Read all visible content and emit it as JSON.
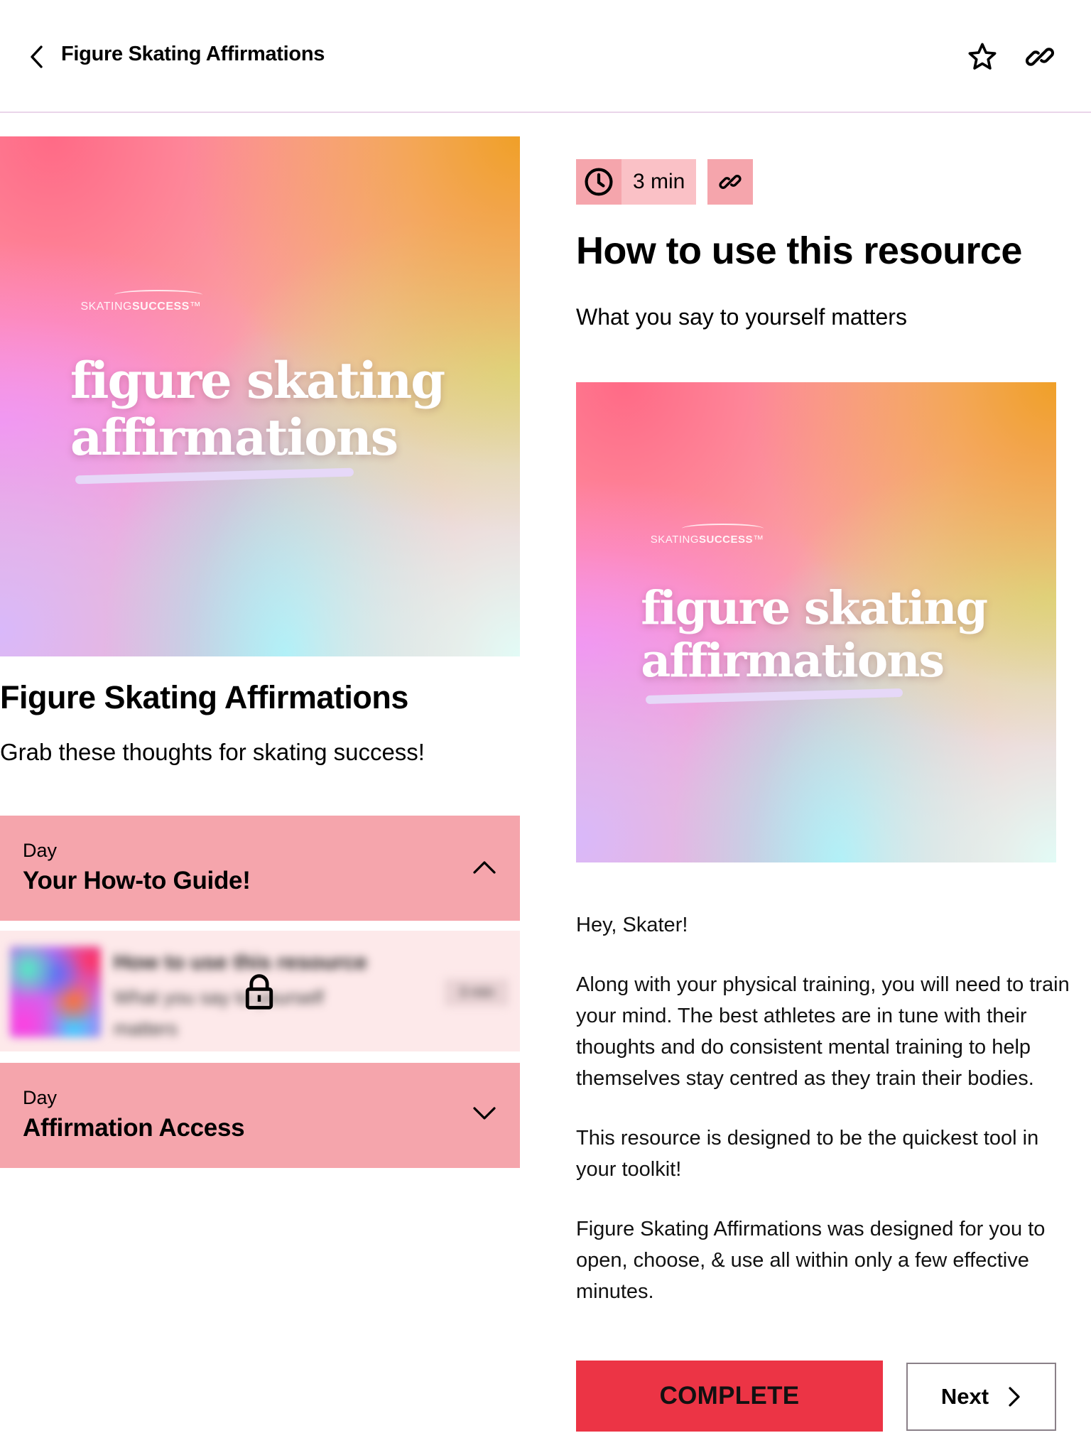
{
  "header": {
    "title": "Figure Skating Affirmations",
    "icons": {
      "back": "chevron-left-icon",
      "favorite": "star-outline-icon",
      "share": "link-icon"
    }
  },
  "resource": {
    "cover_art": {
      "brand_light": "SKATING",
      "brand_bold": "SUCCESS",
      "brand_tm": "™",
      "title_line1": "figure skating",
      "title_line2": "affirmations"
    },
    "title": "Figure Skating Affirmations",
    "subtitle": "Grab these thoughts for skating success!"
  },
  "days": [
    {
      "label": "Day",
      "title": "Your How-to Guide!",
      "expanded": true,
      "items": [
        {
          "title": "How to use this resource",
          "subtitle": "What you say to yourself matters",
          "duration": "3 min",
          "locked": true
        }
      ]
    },
    {
      "label": "Day",
      "title": "Affirmation Access",
      "expanded": false,
      "items": []
    }
  ],
  "lesson": {
    "duration": "3 min",
    "title": "How to use this resource",
    "subtitle": "What you say to yourself matters",
    "image_art": {
      "brand_light": "SKATING",
      "brand_bold": "SUCCESS",
      "brand_tm": "™",
      "title_line1": "figure skating",
      "title_line2": "affirmations"
    },
    "paragraphs": [
      "Hey, Skater!",
      "Along with your physical training, you will need to train your mind. The best athletes are in tune with their thoughts and do consistent mental training to help themselves stay centred as they train their bodies.",
      "This resource is designed to be the quickest tool in your toolkit!",
      "Figure Skating Affirmations was designed for you to open, choose, & use all within only a few effective minutes."
    ],
    "complete_label": "COMPLETE",
    "next_label": "Next"
  },
  "colors": {
    "panel_pink": "#f5a5ac",
    "badge_pink": "#fac1c6",
    "complete_red": "#ec3445",
    "divider": "#ead5ea"
  }
}
